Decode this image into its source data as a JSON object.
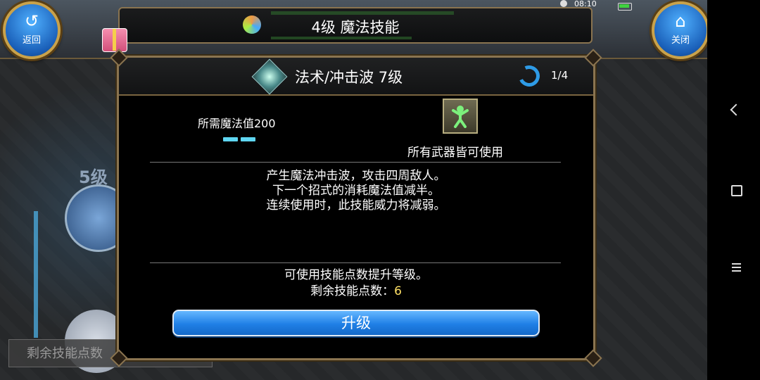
{
  "status_bar": {
    "time": "08:10"
  },
  "nav": {
    "back_label": "返回",
    "close_label": "关闭"
  },
  "header": {
    "title": "4级 魔法技能"
  },
  "background": {
    "level_label": "5级",
    "remaining_points_label": "剩余技能点数"
  },
  "dialog": {
    "skill_name": "法术/冲击波 7级",
    "page_indicator": "1/4",
    "mp_requirement": "所需魔法值200",
    "weapon_text": "所有武器皆可使用",
    "description": [
      "产生魔法冲击波，攻击四周敌人。",
      "下一个招式的消耗魔法值减半。",
      "连续使用时，此技能威力将减弱。"
    ],
    "upgrade_hint": "可使用技能点数提升等级。",
    "remaining_label": "剩余技能点数：",
    "remaining_value": "6",
    "upgrade_button": "升级"
  },
  "icons": {
    "back": "back-arrow-icon",
    "close": "home-icon",
    "skill": "skill-crystal-icon",
    "refresh": "refresh-icon",
    "weapon": "stick-figure-icon",
    "gift": "gift-icon"
  },
  "colors": {
    "accent_blue": "#1f7fe6",
    "gold_border": "#8a7450",
    "points_value": "#ffe066",
    "mp_bar": "#5fd6f2"
  }
}
